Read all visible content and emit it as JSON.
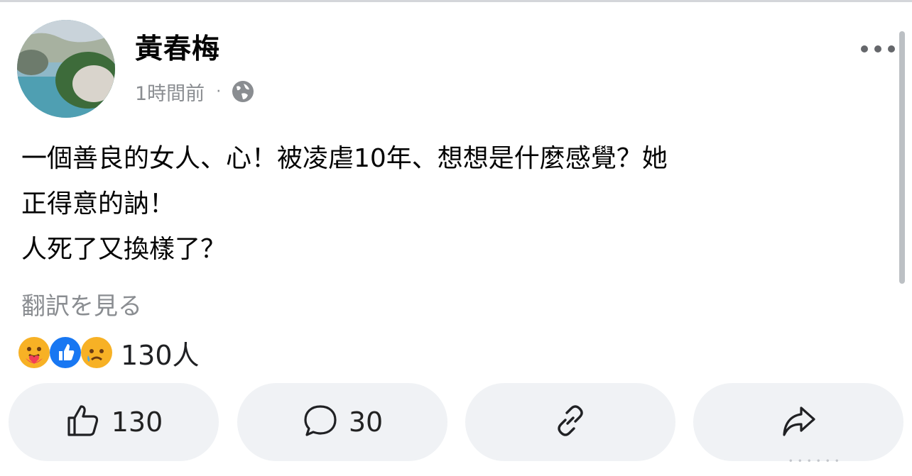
{
  "post": {
    "author": "黃春梅",
    "timestamp": "1時間前",
    "separator": "·",
    "privacy_icon": "globe-icon",
    "more_icon": "more-horizontal-icon",
    "body_lines": [
      "一個善良的女人、心！被凌虐10年、想想是什麼感覺？她",
      "正得意的訥！",
      "人死了又換樣了？"
    ],
    "translate_label": "翻訳を見る"
  },
  "reactions": {
    "icons": [
      "care-reaction-icon",
      "like-reaction-icon",
      "sad-reaction-icon"
    ],
    "count_label": "130人"
  },
  "actions": {
    "like": {
      "icon": "thumbs-up-icon",
      "count": "130"
    },
    "comment": {
      "icon": "comment-bubble-icon",
      "count": "30"
    },
    "link": {
      "icon": "link-icon"
    },
    "share": {
      "icon": "share-arrow-icon"
    }
  },
  "watermark": "．．．．．．"
}
